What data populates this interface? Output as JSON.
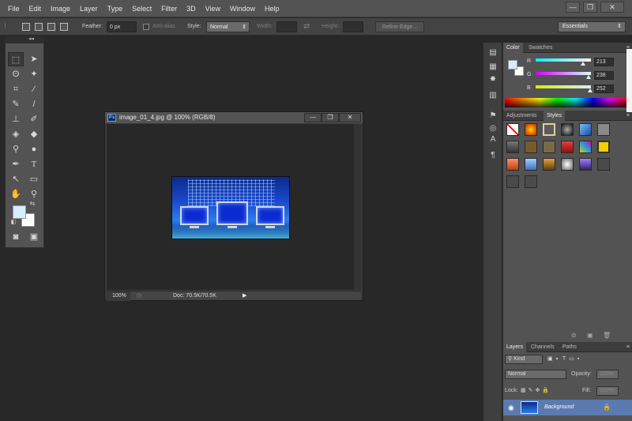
{
  "menu": [
    "File",
    "Edit",
    "Image",
    "Layer",
    "Type",
    "Select",
    "Filter",
    "3D",
    "View",
    "Window",
    "Help"
  ],
  "window_controls": {
    "minimize": "—",
    "restore": "❐",
    "close": "✕"
  },
  "options": {
    "feather_label": "Feather:",
    "feather_value": "0 px",
    "antialias_label": "Anti-alias",
    "style_label": "Style:",
    "style_value": "Normal",
    "width_label": "Width:",
    "height_label": "Height:",
    "refine_label": "Refine Edge...",
    "workspace": "Essentials"
  },
  "document": {
    "title": "image_01_4.jpg @ 100% (RGB/8)",
    "ps_badge": "Ps",
    "zoom": "100%",
    "doc_size": "Doc: 70.5K/70.5K"
  },
  "color_panel": {
    "tabs": [
      "Color",
      "Swatches"
    ],
    "r_label": "R",
    "r_value": "213",
    "g_label": "G",
    "g_value": "238",
    "b_label": "B",
    "b_value": "252"
  },
  "styles_panel": {
    "tabs": [
      "Adjustments",
      "Styles"
    ]
  },
  "layers_panel": {
    "tabs": [
      "Layers",
      "Channels",
      "Paths"
    ],
    "kind": "Kind",
    "blend_mode": "Normal",
    "opacity_label": "Opacity:",
    "opacity_value": "100%",
    "lock_label": "Lock:",
    "fill_label": "Fill:",
    "fill_value": "100%",
    "layer_name": "Background"
  },
  "colors": {
    "foreground": "#d5eefc",
    "background": "#ffffff"
  }
}
